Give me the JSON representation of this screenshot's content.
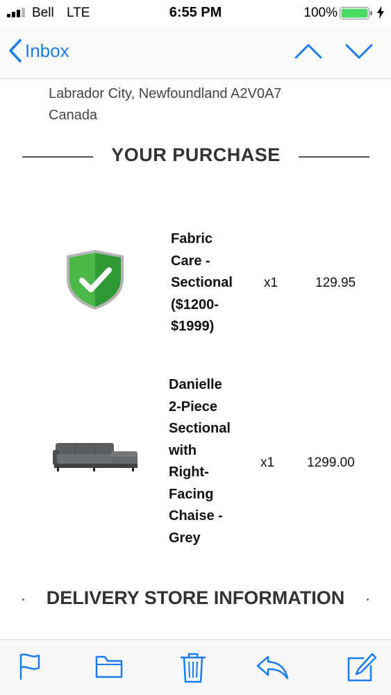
{
  "status_bar": {
    "carrier": "Bell",
    "network": "LTE",
    "time": "6:55 PM",
    "battery_percent": "100%",
    "battery_level": 1.0,
    "signal_bars": 3,
    "signal_max": 4
  },
  "nav": {
    "back_label": "Inbox"
  },
  "address": {
    "line1": "Labrador City, Newfoundland A2V0A7",
    "line2": "Canada"
  },
  "purchase": {
    "heading": "YOUR PURCHASE",
    "items": [
      {
        "name_lines": [
          "Fabric",
          "Care -",
          "Sectional",
          "($1200-",
          "$1999)"
        ],
        "quantity": "x1",
        "price": "129.95",
        "image": "protection-shield-icon"
      },
      {
        "name_lines": [
          "Danielle",
          "2-Piece",
          "Sectional",
          "with",
          "Right-",
          "Facing",
          "Chaise -",
          "Grey"
        ],
        "quantity": "x1",
        "price": "1299.00",
        "image": "grey-sectional-sofa"
      }
    ]
  },
  "delivery": {
    "heading": "DELIVERY STORE INFORMATION"
  },
  "toolbar": {
    "icons": [
      "flag-icon",
      "folder-icon",
      "trash-icon",
      "reply-icon",
      "compose-icon"
    ]
  },
  "colors": {
    "accent": "#1a7cf5",
    "battery_fill": "#4cd964",
    "shield_green": "#3aa63a"
  }
}
